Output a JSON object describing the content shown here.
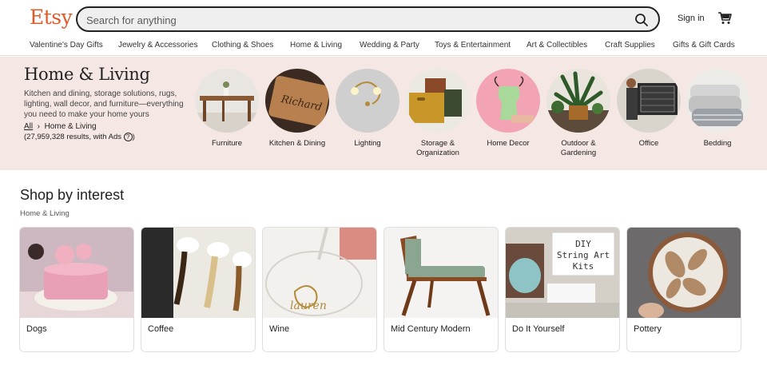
{
  "header": {
    "logo": "Etsy",
    "search_placeholder": "Search for anything",
    "signin_label": "Sign in"
  },
  "nav": {
    "items": [
      "Valentine's Day Gifts",
      "Jewelry & Accessories",
      "Clothing & Shoes",
      "Home & Living",
      "Wedding & Party",
      "Toys & Entertainment",
      "Art & Collectibles",
      "Craft Supplies",
      "Gifts & Gift Cards"
    ]
  },
  "hero": {
    "title": "Home & Living",
    "description": "Kitchen and dining, storage solutions, rugs, lighting, wall decor, and furniture—everything you need to make your home yours",
    "breadcrumb_all": "All",
    "breadcrumb_current": "Home & Living",
    "results": "(27,959,328 results, with Ads",
    "results_close": ")",
    "categories": [
      {
        "label": "Furniture",
        "icon": "furniture-image"
      },
      {
        "label": "Kitchen & Dining",
        "icon": "kitchen-image"
      },
      {
        "label": "Lighting",
        "icon": "lighting-image"
      },
      {
        "label": "Storage & Organization",
        "icon": "storage-image"
      },
      {
        "label": "Home Decor",
        "icon": "home-decor-image"
      },
      {
        "label": "Outdoor & Gardening",
        "icon": "outdoor-image"
      },
      {
        "label": "Office",
        "icon": "office-image"
      },
      {
        "label": "Bedding",
        "icon": "bedding-image"
      }
    ]
  },
  "interest": {
    "title": "Shop by interest",
    "subtitle": "Home & Living",
    "cards": [
      {
        "label": "Dogs"
      },
      {
        "label": "Coffee"
      },
      {
        "label": "Wine"
      },
      {
        "label": "Mid Century Modern"
      },
      {
        "label": "Do It Yourself"
      },
      {
        "label": "Pottery"
      }
    ]
  },
  "colors": {
    "brand": "#e05a2a",
    "hero_bg": "#f4e7e4",
    "search_bg": "#f0efef"
  }
}
